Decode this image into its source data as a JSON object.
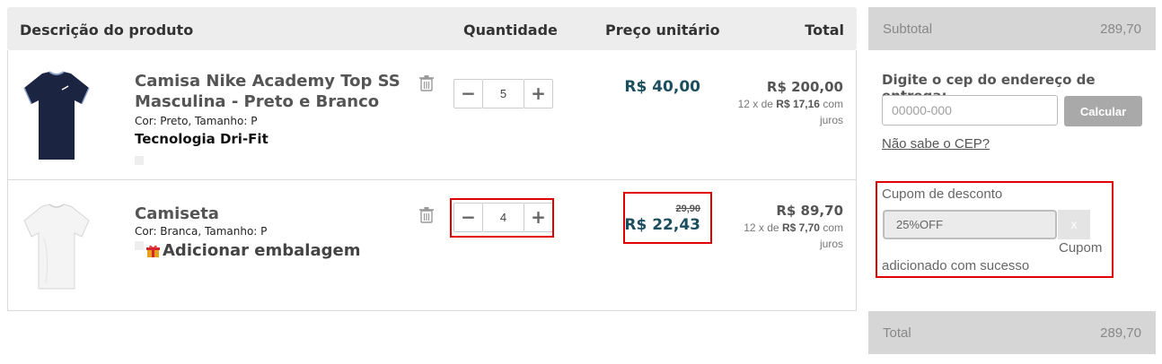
{
  "table": {
    "headers": {
      "description": "Descrição do produto",
      "quantity": "Quantidade",
      "unit_price": "Preço unitário",
      "total": "Total"
    },
    "items": [
      {
        "name": "Camisa Nike Academy Top SS Masculina - Preto e Branco",
        "attributes": "Cor: Preto, Tamanho: P",
        "extra": "Tecnologia Dri-Fit",
        "quantity": "5",
        "unit_price": "R$ 40,00",
        "total": "R$ 200,00",
        "installments_prefix": "12 x de",
        "installment_value": "R$ 17,16",
        "installments_suffix": "com juros",
        "shirt_color": "#1b2440"
      },
      {
        "name": "Camiseta",
        "attributes": "Cor: Branca, Tamanho: P",
        "extra": "Adicionar embalagem",
        "quantity": "4",
        "old_price": "29,90",
        "unit_price": "R$ 22,43",
        "total": "R$ 89,70",
        "installments_prefix": "12 x de",
        "installment_value": "R$ 7,70",
        "installments_suffix": "com juros",
        "shirt_color": "#f4f4f4"
      }
    ],
    "qty_minus": "−",
    "qty_plus": "+",
    "trash_icon": "trash-icon",
    "gift_icon": "gift-icon"
  },
  "sidebar": {
    "subtotal_label": "Subtotal",
    "subtotal_value": "289,70",
    "cep_label": "Digite o cep do endereço de entrega:",
    "cep_placeholder": "00000-000",
    "cep_button": "Calcular",
    "cep_link": "Não sabe o CEP?",
    "coupon_label": "Cupom de desconto",
    "coupon_value": "25%OFF",
    "coupon_remove": "x",
    "coupon_msg_part1": "Cupom",
    "coupon_msg_part2": "adicionado com sucesso",
    "total_label": "Total",
    "total_value": "289,70"
  },
  "colors": {
    "accent_price": "#1c4f5e",
    "highlight": "#e00000",
    "header_bg": "#ededed",
    "summary_bg": "#d6d6d6"
  }
}
